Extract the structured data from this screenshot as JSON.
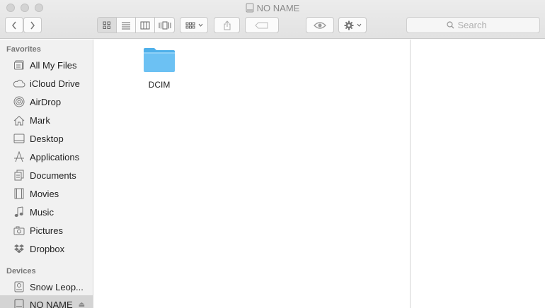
{
  "window": {
    "title": "NO NAME"
  },
  "toolbar": {
    "search_placeholder": "Search"
  },
  "sidebar": {
    "favorites_header": "Favorites",
    "favorites": [
      {
        "label": "All My Files",
        "icon": "all-files-icon"
      },
      {
        "label": "iCloud Drive",
        "icon": "cloud-icon"
      },
      {
        "label": "AirDrop",
        "icon": "airdrop-icon"
      },
      {
        "label": "Mark",
        "icon": "home-icon"
      },
      {
        "label": "Desktop",
        "icon": "desktop-icon"
      },
      {
        "label": "Applications",
        "icon": "applications-icon"
      },
      {
        "label": "Documents",
        "icon": "documents-icon"
      },
      {
        "label": "Movies",
        "icon": "movies-icon"
      },
      {
        "label": "Music",
        "icon": "music-icon"
      },
      {
        "label": "Pictures",
        "icon": "pictures-icon"
      },
      {
        "label": "Dropbox",
        "icon": "dropbox-icon"
      }
    ],
    "devices_header": "Devices",
    "devices": [
      {
        "label": "Snow Leop...",
        "icon": "hard-drive-icon"
      },
      {
        "label": "NO NAME",
        "icon": "external-drive-icon",
        "selected": true
      }
    ]
  },
  "content": {
    "items": [
      {
        "label": "DCIM",
        "type": "folder"
      }
    ]
  },
  "colors": {
    "folder": "#6cc1f3",
    "sidebar_bg": "#f1f1f1",
    "selected": "#d4d4d4"
  }
}
